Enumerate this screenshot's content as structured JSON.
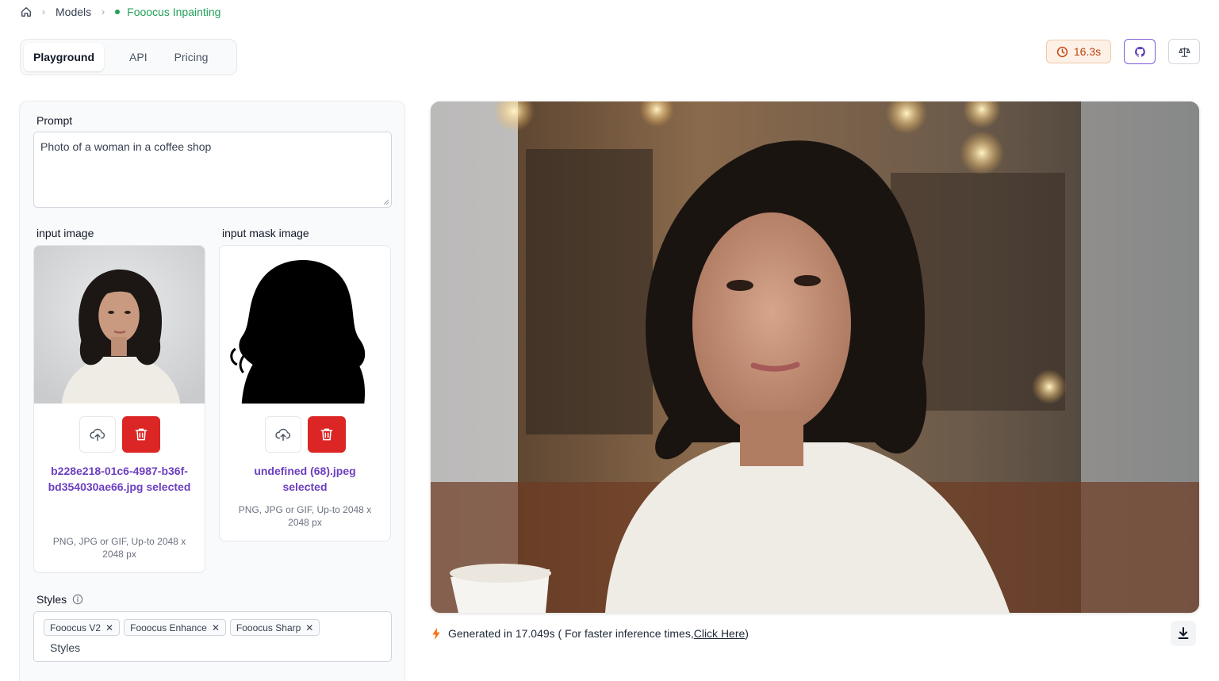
{
  "breadcrumb": {
    "models": "Models",
    "current": "Fooocus Inpainting"
  },
  "tabs": [
    {
      "label": "Playground"
    },
    {
      "label": "API"
    },
    {
      "label": "Pricing"
    }
  ],
  "header": {
    "timer": "16.3s"
  },
  "prompt": {
    "label": "Prompt",
    "value": "Photo of a woman in a coffee shop"
  },
  "input_image": {
    "label": "input image",
    "filename": "b228e218-01c6-4987-b36f-bd354030ae66.jpg selected",
    "hint": "PNG, JPG or GIF, Up-to 2048 x 2048 px"
  },
  "mask_image": {
    "label": "input mask image",
    "filename": "undefined (68).jpeg selected",
    "hint": "PNG, JPG or GIF, Up-to 2048 x 2048 px"
  },
  "styles": {
    "label": "Styles",
    "chips": [
      "Fooocus V2",
      "Fooocus Enhance",
      "Fooocus Sharp"
    ],
    "placeholder": "Styles"
  },
  "output": {
    "generated_prefix": "Generated in 17.049s ( For faster inference times, ",
    "link": "Click Here",
    "generated_suffix": " )"
  },
  "colors": {
    "accent_green": "#22a05a",
    "accent_purple": "#6d3fc0",
    "danger": "#dc2626",
    "timer_text": "#c2410c"
  }
}
